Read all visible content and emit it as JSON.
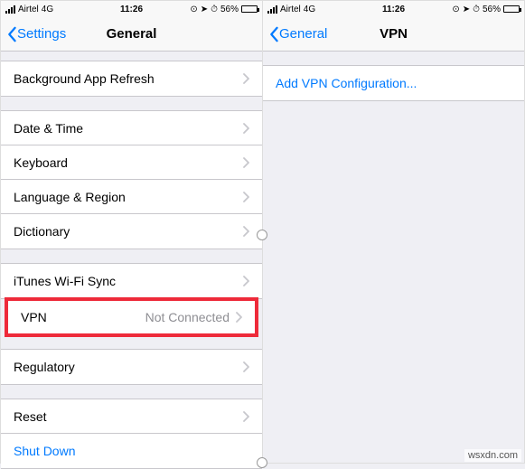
{
  "status": {
    "carrier": "Airtel",
    "network": "4G",
    "time": "11:26",
    "battery_pct": "56%"
  },
  "left": {
    "back_label": "Settings",
    "title": "General",
    "rows": {
      "bg_refresh": "Background App Refresh",
      "date_time": "Date & Time",
      "keyboard": "Keyboard",
      "lang_region": "Language & Region",
      "dictionary": "Dictionary",
      "itunes_wifi": "iTunes Wi-Fi Sync",
      "vpn": "VPN",
      "vpn_status": "Not Connected",
      "regulatory": "Regulatory",
      "reset": "Reset",
      "shutdown": "Shut Down"
    }
  },
  "right": {
    "back_label": "General",
    "title": "VPN",
    "add_vpn": "Add VPN Configuration..."
  },
  "watermark": "wsxdn.com"
}
